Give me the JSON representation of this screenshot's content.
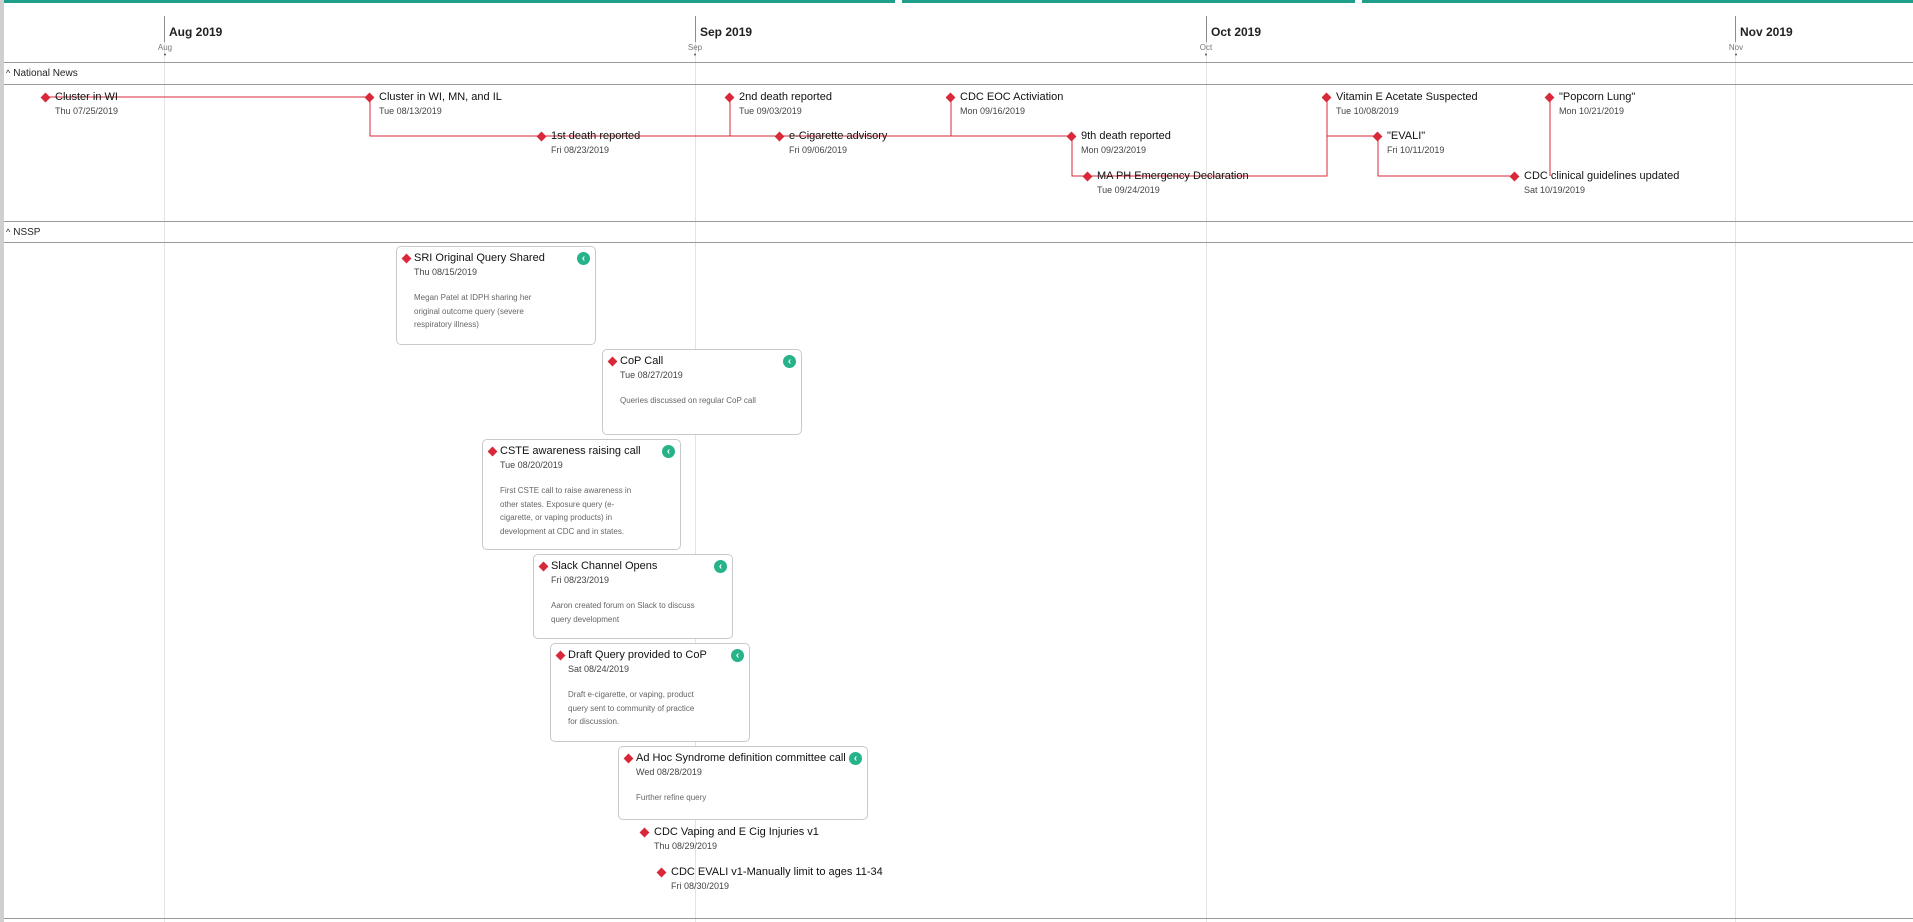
{
  "colors": {
    "accent": "#1f9e8a",
    "marker": "#d9283a",
    "link_badge": "#27b38a"
  },
  "timeline": {
    "months": [
      "Aug 2019",
      "Sep 2019",
      "Oct 2019",
      "Nov 2019"
    ],
    "ticks": [
      "Aug",
      "Sep",
      "Oct",
      "Nov"
    ]
  },
  "sections": {
    "national_news": {
      "title": "National News",
      "events": [
        {
          "title": "Cluster in WI",
          "date": "Thu 07/25/2019"
        },
        {
          "title": "Cluster in WI, MN, and IL",
          "date": "Tue 08/13/2019"
        },
        {
          "title": "1st death reported",
          "date": "Fri 08/23/2019"
        },
        {
          "title": "2nd death reported",
          "date": "Tue 09/03/2019"
        },
        {
          "title": "e-Cigarette advisory",
          "date": "Fri 09/06/2019"
        },
        {
          "title": "CDC EOC Activiation",
          "date": "Mon 09/16/2019"
        },
        {
          "title": "9th death reported",
          "date": "Mon 09/23/2019"
        },
        {
          "title": "MA PH Emergency Declaration",
          "date": "Tue 09/24/2019"
        },
        {
          "title": "Vitamin E Acetate Suspected",
          "date": "Tue 10/08/2019"
        },
        {
          "title": "\"EVALI\"",
          "date": "Fri 10/11/2019"
        },
        {
          "title": "\"Popcorn Lung\"",
          "date": "Mon 10/21/2019"
        },
        {
          "title": "CDC clinical guidelines updated",
          "date": "Sat 10/19/2019"
        }
      ]
    },
    "nssp": {
      "title": "NSSP",
      "cards": [
        {
          "title": "SRI Original Query Shared",
          "date": "Thu 08/15/2019",
          "description": "Megan Patel at IDPH sharing her original outcome query (severe respiratory illness)",
          "link_icon": "link-badge-icon"
        },
        {
          "title": "CoP Call",
          "date": "Tue 08/27/2019",
          "description": "Queries discussed on regular CoP call",
          "link_icon": "link-badge-icon"
        },
        {
          "title": "CSTE awareness raising call",
          "date": "Tue 08/20/2019",
          "description": "First CSTE call to raise awareness in other states. Exposure query (e-cigarette, or vaping products) in development at CDC and in states.",
          "link_icon": "link-badge-icon"
        },
        {
          "title": "Slack Channel Opens",
          "date": "Fri 08/23/2019",
          "description": "Aaron created forum on Slack to discuss query development",
          "link_icon": "link-badge-icon"
        },
        {
          "title": "Draft Query provided to CoP",
          "date": "Sat 08/24/2019",
          "description": "Draft e-cigarette, or vaping, product query sent to community of practice for discussion.",
          "link_icon": "link-badge-icon"
        },
        {
          "title": "Ad Hoc Syndrome definition committee call",
          "date": "Wed 08/28/2019",
          "description": "Further refine query",
          "link_icon": "link-badge-icon"
        }
      ],
      "events": [
        {
          "title": "CDC Vaping and E Cig Injuries v1",
          "date": "Thu 08/29/2019"
        },
        {
          "title": "CDC EVALI v1-Manually limit to ages 11-34",
          "date": "Fri 08/30/2019"
        }
      ]
    }
  }
}
